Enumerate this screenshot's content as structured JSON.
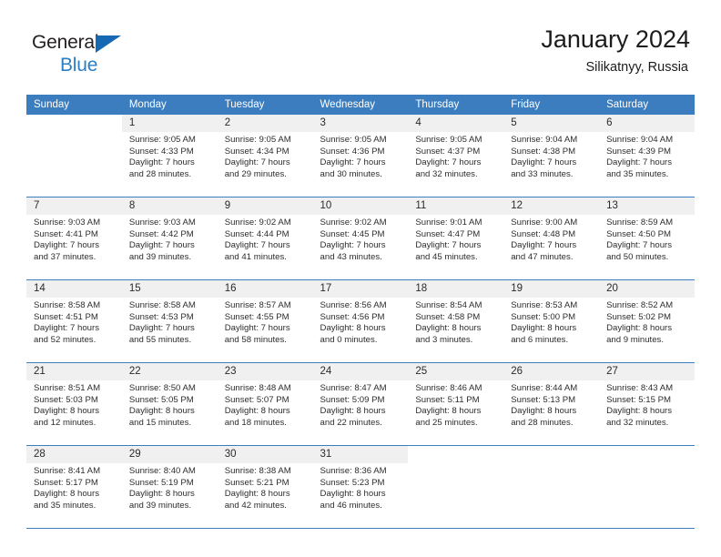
{
  "brand": {
    "line1": "General",
    "line2": "Blue",
    "triangle_color": "#1668b3"
  },
  "header": {
    "title": "January 2024",
    "subtitle": "Silikatnyy, Russia",
    "header_bg": "#3b7dbf",
    "daynum_bg": "#f0f0f0"
  },
  "weekday_headers": [
    "Sunday",
    "Monday",
    "Tuesday",
    "Wednesday",
    "Thursday",
    "Friday",
    "Saturday"
  ],
  "weeks": [
    [
      {
        "day": "",
        "sunrise": "",
        "sunset": "",
        "daylight1": "",
        "daylight2": ""
      },
      {
        "day": "1",
        "sunrise": "Sunrise: 9:05 AM",
        "sunset": "Sunset: 4:33 PM",
        "daylight1": "Daylight: 7 hours",
        "daylight2": "and 28 minutes."
      },
      {
        "day": "2",
        "sunrise": "Sunrise: 9:05 AM",
        "sunset": "Sunset: 4:34 PM",
        "daylight1": "Daylight: 7 hours",
        "daylight2": "and 29 minutes."
      },
      {
        "day": "3",
        "sunrise": "Sunrise: 9:05 AM",
        "sunset": "Sunset: 4:36 PM",
        "daylight1": "Daylight: 7 hours",
        "daylight2": "and 30 minutes."
      },
      {
        "day": "4",
        "sunrise": "Sunrise: 9:05 AM",
        "sunset": "Sunset: 4:37 PM",
        "daylight1": "Daylight: 7 hours",
        "daylight2": "and 32 minutes."
      },
      {
        "day": "5",
        "sunrise": "Sunrise: 9:04 AM",
        "sunset": "Sunset: 4:38 PM",
        "daylight1": "Daylight: 7 hours",
        "daylight2": "and 33 minutes."
      },
      {
        "day": "6",
        "sunrise": "Sunrise: 9:04 AM",
        "sunset": "Sunset: 4:39 PM",
        "daylight1": "Daylight: 7 hours",
        "daylight2": "and 35 minutes."
      }
    ],
    [
      {
        "day": "7",
        "sunrise": "Sunrise: 9:03 AM",
        "sunset": "Sunset: 4:41 PM",
        "daylight1": "Daylight: 7 hours",
        "daylight2": "and 37 minutes."
      },
      {
        "day": "8",
        "sunrise": "Sunrise: 9:03 AM",
        "sunset": "Sunset: 4:42 PM",
        "daylight1": "Daylight: 7 hours",
        "daylight2": "and 39 minutes."
      },
      {
        "day": "9",
        "sunrise": "Sunrise: 9:02 AM",
        "sunset": "Sunset: 4:44 PM",
        "daylight1": "Daylight: 7 hours",
        "daylight2": "and 41 minutes."
      },
      {
        "day": "10",
        "sunrise": "Sunrise: 9:02 AM",
        "sunset": "Sunset: 4:45 PM",
        "daylight1": "Daylight: 7 hours",
        "daylight2": "and 43 minutes."
      },
      {
        "day": "11",
        "sunrise": "Sunrise: 9:01 AM",
        "sunset": "Sunset: 4:47 PM",
        "daylight1": "Daylight: 7 hours",
        "daylight2": "and 45 minutes."
      },
      {
        "day": "12",
        "sunrise": "Sunrise: 9:00 AM",
        "sunset": "Sunset: 4:48 PM",
        "daylight1": "Daylight: 7 hours",
        "daylight2": "and 47 minutes."
      },
      {
        "day": "13",
        "sunrise": "Sunrise: 8:59 AM",
        "sunset": "Sunset: 4:50 PM",
        "daylight1": "Daylight: 7 hours",
        "daylight2": "and 50 minutes."
      }
    ],
    [
      {
        "day": "14",
        "sunrise": "Sunrise: 8:58 AM",
        "sunset": "Sunset: 4:51 PM",
        "daylight1": "Daylight: 7 hours",
        "daylight2": "and 52 minutes."
      },
      {
        "day": "15",
        "sunrise": "Sunrise: 8:58 AM",
        "sunset": "Sunset: 4:53 PM",
        "daylight1": "Daylight: 7 hours",
        "daylight2": "and 55 minutes."
      },
      {
        "day": "16",
        "sunrise": "Sunrise: 8:57 AM",
        "sunset": "Sunset: 4:55 PM",
        "daylight1": "Daylight: 7 hours",
        "daylight2": "and 58 minutes."
      },
      {
        "day": "17",
        "sunrise": "Sunrise: 8:56 AM",
        "sunset": "Sunset: 4:56 PM",
        "daylight1": "Daylight: 8 hours",
        "daylight2": "and 0 minutes."
      },
      {
        "day": "18",
        "sunrise": "Sunrise: 8:54 AM",
        "sunset": "Sunset: 4:58 PM",
        "daylight1": "Daylight: 8 hours",
        "daylight2": "and 3 minutes."
      },
      {
        "day": "19",
        "sunrise": "Sunrise: 8:53 AM",
        "sunset": "Sunset: 5:00 PM",
        "daylight1": "Daylight: 8 hours",
        "daylight2": "and 6 minutes."
      },
      {
        "day": "20",
        "sunrise": "Sunrise: 8:52 AM",
        "sunset": "Sunset: 5:02 PM",
        "daylight1": "Daylight: 8 hours",
        "daylight2": "and 9 minutes."
      }
    ],
    [
      {
        "day": "21",
        "sunrise": "Sunrise: 8:51 AM",
        "sunset": "Sunset: 5:03 PM",
        "daylight1": "Daylight: 8 hours",
        "daylight2": "and 12 minutes."
      },
      {
        "day": "22",
        "sunrise": "Sunrise: 8:50 AM",
        "sunset": "Sunset: 5:05 PM",
        "daylight1": "Daylight: 8 hours",
        "daylight2": "and 15 minutes."
      },
      {
        "day": "23",
        "sunrise": "Sunrise: 8:48 AM",
        "sunset": "Sunset: 5:07 PM",
        "daylight1": "Daylight: 8 hours",
        "daylight2": "and 18 minutes."
      },
      {
        "day": "24",
        "sunrise": "Sunrise: 8:47 AM",
        "sunset": "Sunset: 5:09 PM",
        "daylight1": "Daylight: 8 hours",
        "daylight2": "and 22 minutes."
      },
      {
        "day": "25",
        "sunrise": "Sunrise: 8:46 AM",
        "sunset": "Sunset: 5:11 PM",
        "daylight1": "Daylight: 8 hours",
        "daylight2": "and 25 minutes."
      },
      {
        "day": "26",
        "sunrise": "Sunrise: 8:44 AM",
        "sunset": "Sunset: 5:13 PM",
        "daylight1": "Daylight: 8 hours",
        "daylight2": "and 28 minutes."
      },
      {
        "day": "27",
        "sunrise": "Sunrise: 8:43 AM",
        "sunset": "Sunset: 5:15 PM",
        "daylight1": "Daylight: 8 hours",
        "daylight2": "and 32 minutes."
      }
    ],
    [
      {
        "day": "28",
        "sunrise": "Sunrise: 8:41 AM",
        "sunset": "Sunset: 5:17 PM",
        "daylight1": "Daylight: 8 hours",
        "daylight2": "and 35 minutes."
      },
      {
        "day": "29",
        "sunrise": "Sunrise: 8:40 AM",
        "sunset": "Sunset: 5:19 PM",
        "daylight1": "Daylight: 8 hours",
        "daylight2": "and 39 minutes."
      },
      {
        "day": "30",
        "sunrise": "Sunrise: 8:38 AM",
        "sunset": "Sunset: 5:21 PM",
        "daylight1": "Daylight: 8 hours",
        "daylight2": "and 42 minutes."
      },
      {
        "day": "31",
        "sunrise": "Sunrise: 8:36 AM",
        "sunset": "Sunset: 5:23 PM",
        "daylight1": "Daylight: 8 hours",
        "daylight2": "and 46 minutes."
      },
      {
        "day": "",
        "sunrise": "",
        "sunset": "",
        "daylight1": "",
        "daylight2": ""
      },
      {
        "day": "",
        "sunrise": "",
        "sunset": "",
        "daylight1": "",
        "daylight2": ""
      },
      {
        "day": "",
        "sunrise": "",
        "sunset": "",
        "daylight1": "",
        "daylight2": ""
      }
    ]
  ]
}
